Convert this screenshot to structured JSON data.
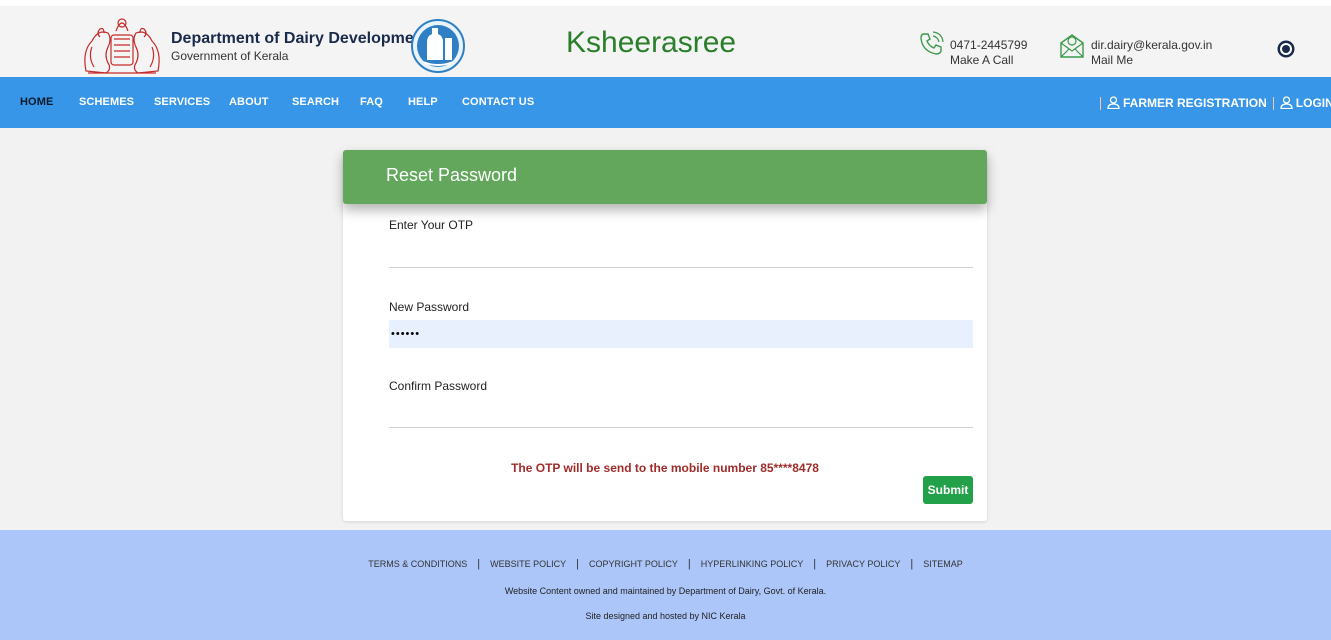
{
  "header": {
    "dept_title": "Department of Dairy Development",
    "dept_subtitle": "Government of Kerala",
    "site_name": "Ksheerasree",
    "phone": {
      "number": "0471-2445799",
      "label": "Make A Call"
    },
    "mail": {
      "address": "dir.dairy@kerala.gov.in",
      "label": "Mail Me"
    }
  },
  "nav": {
    "items": [
      "HOME",
      "SCHEMES",
      "SERVICES",
      "ABOUT",
      "SEARCH",
      "FAQ",
      "HELP",
      "CONTACT US"
    ],
    "active": "HOME",
    "farmer_registration": "FARMER REGISTRATION",
    "login": "LOGIN"
  },
  "form": {
    "title": "Reset Password",
    "otp_label": "Enter Your OTP",
    "otp_value": "",
    "new_password_label": "New Password",
    "new_password_value": "••••••",
    "confirm_password_label": "Confirm Password",
    "confirm_password_value": "",
    "otp_note": "The OTP will be send to the mobile number 85****8478",
    "submit_label": "Submit"
  },
  "footer": {
    "links": [
      "TERMS & CONDITIONS",
      "WEBSITE POLICY",
      "COPYRIGHT POLICY",
      "HYPERLINKING POLICY",
      "PRIVACY POLICY",
      "SITEMAP"
    ],
    "ownership": "Website Content owned and maintained by Department of Dairy, Govt. of Kerala.",
    "hosting": "Site designed and hosted by NIC Kerala"
  },
  "colors": {
    "nav_bg": "#3796e8",
    "card_header": "#63a75d",
    "submit": "#23a04a",
    "note": "#a02b2b",
    "footer_bg": "#acc6f9",
    "site_name": "#2a7f2a"
  },
  "icons": [
    "kerala-emblem-icon",
    "dairy-logo-icon",
    "phone-icon",
    "mail-icon",
    "accessibility-icon",
    "user-icon"
  ]
}
